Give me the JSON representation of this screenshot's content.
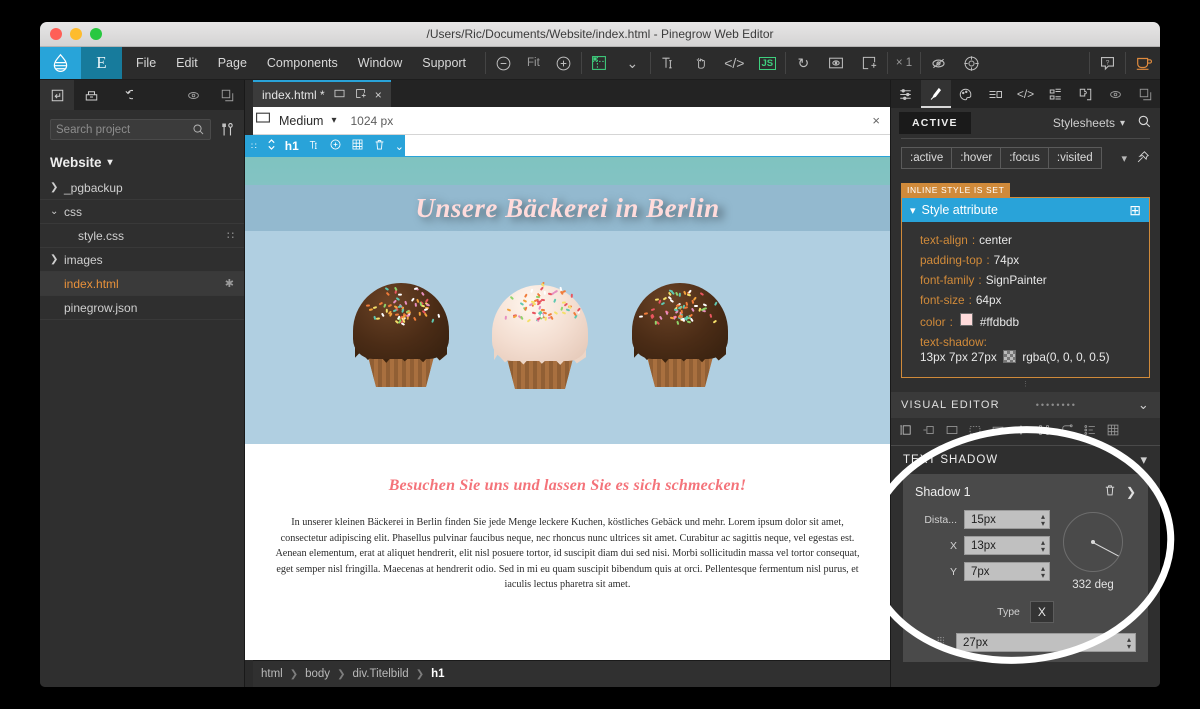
{
  "window": {
    "title": "/Users/Ric/Documents/Website/index.html - Pinegrow Web Editor",
    "logo_letter": "E"
  },
  "menubar": {
    "items": [
      "File",
      "Edit",
      "Page",
      "Components",
      "Window",
      "Support"
    ],
    "zoom_out": "⊖",
    "zoom_label": "Fit",
    "zoom_in": "⊕",
    "grid_icon": "grid-icon",
    "chevron": "⌄",
    "text_icon": "T",
    "hand_icon": "hand-icon",
    "code_icon": "</>",
    "js_icon": "JS",
    "refresh_icon": "↻",
    "preview_icon": "preview-icon",
    "newwin_icon": "newwindow-icon",
    "multiplier": "× 1",
    "eye_off_icon": "eye-off-icon",
    "target_icon": "target-icon",
    "help_icon": "?",
    "cup_icon": "cup-icon"
  },
  "left_panel": {
    "toolbar": {
      "open_icon": "open-project-icon",
      "save_icon": "save-icon",
      "undo_icon": "↺",
      "eye_icon": "eye-icon",
      "copy_icon": "copy-icon"
    },
    "search": {
      "placeholder": "Search project",
      "icon": "search-icon",
      "settings_icon": "tools-icon"
    },
    "project_name": "Website",
    "tree": [
      {
        "label": "_pgbackup",
        "caret": "❯",
        "indent": false,
        "active": false,
        "suffix": ""
      },
      {
        "label": "css",
        "caret": "⌄",
        "indent": false,
        "active": false,
        "suffix": ""
      },
      {
        "label": "style.css",
        "caret": "",
        "indent": true,
        "active": false,
        "suffix": "∷"
      },
      {
        "label": "images",
        "caret": "❯",
        "indent": false,
        "active": false,
        "suffix": ""
      },
      {
        "label": "index.html",
        "caret": "",
        "indent": false,
        "active": true,
        "suffix": "✱"
      },
      {
        "label": "pinegrow.json",
        "caret": "",
        "indent": false,
        "active": false,
        "suffix": ""
      }
    ]
  },
  "center": {
    "tab": {
      "name": "index.html *",
      "window_icon": "window-icon",
      "detach_icon": "detach-icon",
      "close_icon": "×"
    },
    "device_bar": {
      "screen_icon": "screen-icon",
      "label": "Medium",
      "chevron": "⌄",
      "width": "1024 px",
      "close": "×"
    },
    "element_toolbar": {
      "drag_icon": "∷",
      "move_icon": "⌃",
      "tag": "h1",
      "text_icon": "T",
      "add_icon": "add-icon",
      "grid_icon": "grid-icon",
      "trash_icon": "trash-icon",
      "chevron": "⌄"
    },
    "page": {
      "heading": "Unsere Bäckerei in Berlin",
      "cta": "Besuchen Sie uns und lassen Sie es sich schmecken!",
      "body": "In unserer kleinen Bäckerei in Berlin finden Sie jede Menge leckere Kuchen, köstliches Gebäck und mehr.  Lorem ipsum dolor sit amet, consectetur adipiscing elit. Phasellus pulvinar faucibus neque, nec rhoncus nunc ultrices sit amet. Curabitur ac sagittis neque, vel egestas est. Aenean elementum, erat at aliquet hendrerit, elit nisl posuere tortor, id suscipit diam dui sed nisi. Morbi sollicitudin massa vel tortor consequat, eget semper nisl fringilla. Maecenas at hendrerit odio. Sed in mi eu quam suscipit bibendum quis at orci. Pellentesque fermentum nisl purus, et iaculis lectus pharetra sit amet."
    },
    "breadcrumb": [
      "html",
      "body",
      "div.Titelbild",
      "h1"
    ]
  },
  "right_panel": {
    "tabs": [
      {
        "icon": "sliders-icon",
        "active": false
      },
      {
        "icon": "brush-icon",
        "active": true
      },
      {
        "icon": "palette-icon",
        "active": false
      },
      {
        "icon": "list-icon",
        "active": false
      },
      {
        "icon": "code-icon",
        "active": false
      },
      {
        "icon": "layers-icon",
        "active": false
      },
      {
        "icon": "puzzle-icon",
        "active": false
      },
      {
        "icon": "eye-icon",
        "active": false
      },
      {
        "icon": "copy-icon",
        "active": false
      }
    ],
    "header": {
      "active_badge": "ACTIVE",
      "stylesheets_label": "Stylesheets",
      "stylesheets_chevron": "⌄",
      "search_icon": "search-icon"
    },
    "pseudo_classes": [
      ":active",
      ":hover",
      ":focus",
      ":visited"
    ],
    "pseudo_chevron": "⌄",
    "pin_icon": "pin-icon",
    "inline_badge": "INLINE STYLE IS SET",
    "style_block": {
      "title": "Style attribute",
      "chevron": "⌄",
      "add": "⊞",
      "properties": [
        {
          "key": "text-align",
          "value": "center",
          "swatch": ""
        },
        {
          "key": "padding-top",
          "value": "74px",
          "swatch": ""
        },
        {
          "key": "font-family",
          "value": "SignPainter",
          "swatch": ""
        },
        {
          "key": "font-size",
          "value": "64px",
          "swatch": ""
        },
        {
          "key": "color",
          "value": "#ffdbdb",
          "swatch": "pink"
        },
        {
          "key": "text-shadow",
          "value": "13px 7px 27px",
          "value2": "rgba(0, 0, 0, 0.5)",
          "swatch": "check"
        }
      ]
    },
    "visual_editor": {
      "title": "VISUAL EDITOR",
      "dots": "••••••••",
      "chevron": "»",
      "icons": [
        "box-icon",
        "margin-icon",
        "layout-icon",
        "typography-icon",
        "background-icon",
        "border-icon",
        "effects-icon",
        "transform-icon",
        "curve-icon",
        "list-icon",
        "grid-icon"
      ]
    },
    "text_shadow": {
      "title": "TEXT SHADOW",
      "chevron": "⌄",
      "shadow_name": "Shadow 1",
      "trash_icon": "trash-icon",
      "arrow_icon": "❯",
      "fields": [
        {
          "label": "Dista...",
          "value": "15px",
          "name": "distance"
        },
        {
          "label": "X",
          "value": "13px",
          "name": "x-offset"
        },
        {
          "label": "Y",
          "value": "7px",
          "name": "y-offset"
        }
      ],
      "angle": "332 deg",
      "type_label": "Type",
      "type_value": "X",
      "blur_value": "27px",
      "blur_icon": "blur-icon"
    }
  },
  "colors": {
    "accent_blue": "#29a3d9",
    "accent_orange": "#d08a3a",
    "heading_pink": "#ffdbdb",
    "cta_pink": "#f4737a",
    "photo_bg": "#b0cfe1"
  }
}
